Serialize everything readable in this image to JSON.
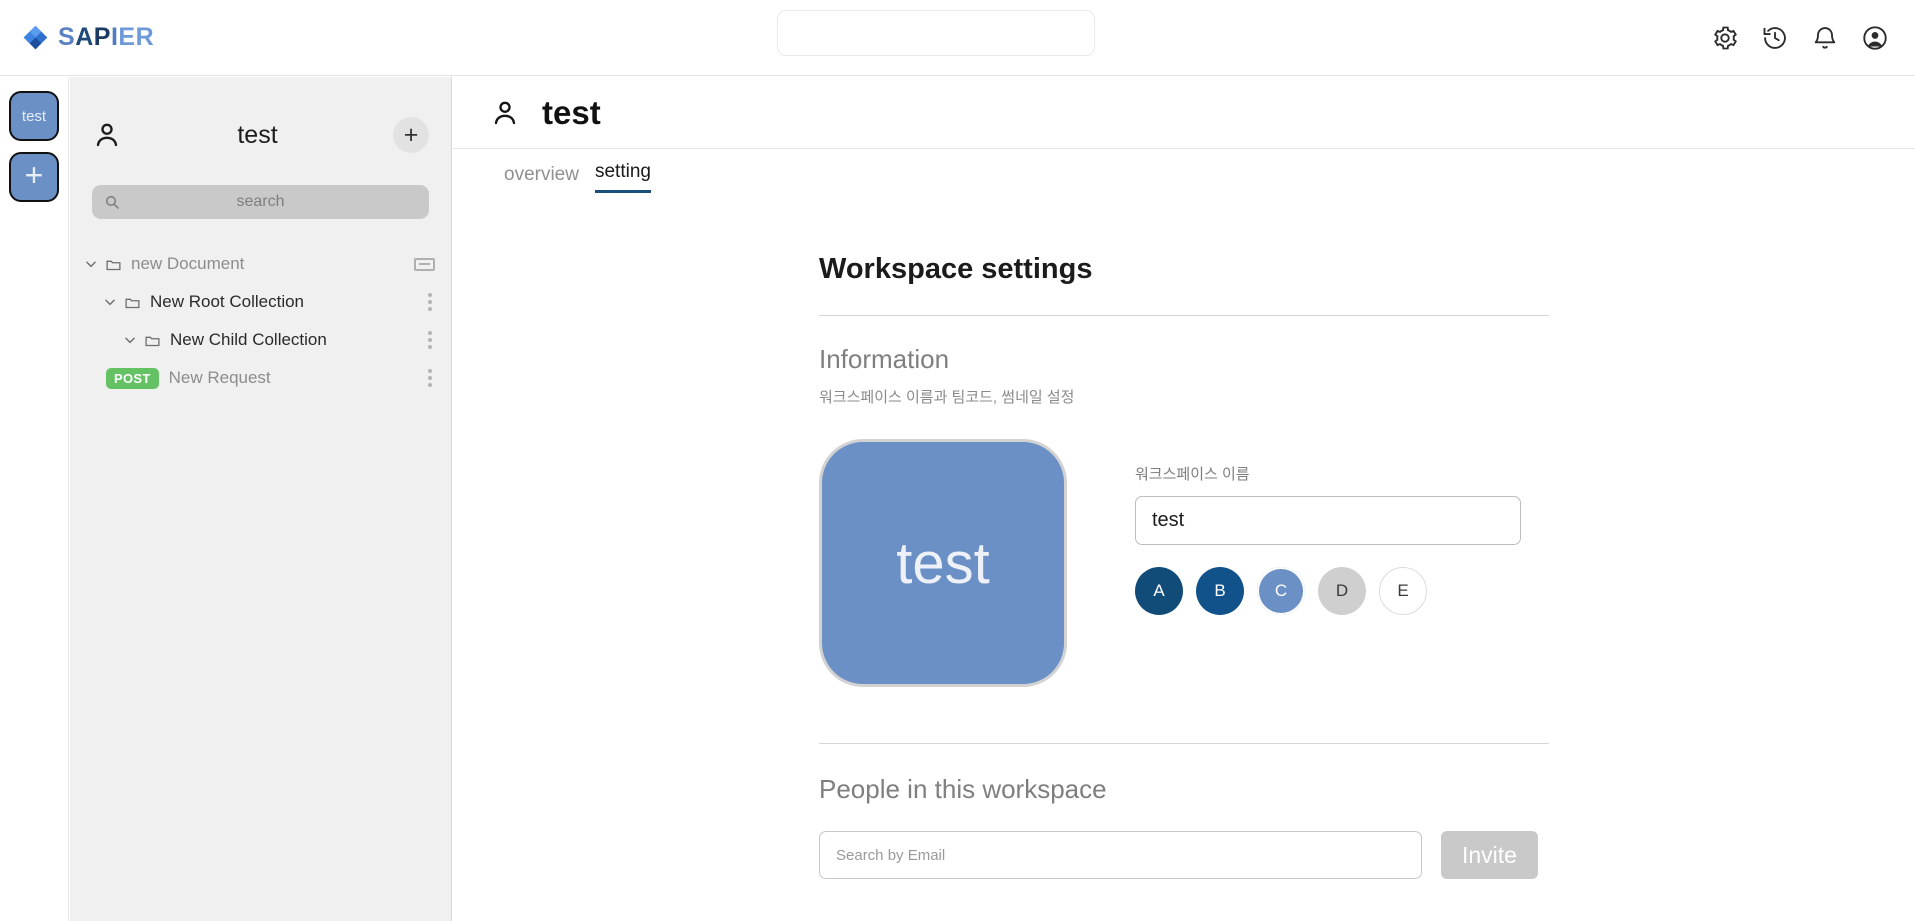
{
  "header": {
    "brand": {
      "letters": [
        "S",
        "A",
        "P",
        "I",
        "E",
        "R"
      ],
      "logo_icon": "diamond-logo-icon"
    },
    "search": {
      "value": "",
      "placeholder": ""
    },
    "icons": [
      {
        "name": "gear-icon",
        "label": "Settings"
      },
      {
        "name": "history-icon",
        "label": "History"
      },
      {
        "name": "bell-icon",
        "label": "Notifications"
      },
      {
        "name": "account-circle-icon",
        "label": "Account"
      }
    ]
  },
  "rail": {
    "workspace_button": "test",
    "add_button": "+"
  },
  "sidebar": {
    "person_icon": "person-icon",
    "title": "test",
    "add_label": "+",
    "search": {
      "value": "",
      "placeholder": "search",
      "icon": "search-icon"
    },
    "tree": [
      {
        "label": "new Document",
        "indent": 0,
        "style": "muted",
        "icon": "folder-icon",
        "chevron": "chevron-down-icon",
        "action": "rect-icon",
        "badge": null
      },
      {
        "label": "New Root Collection",
        "indent": 1,
        "style": "dark",
        "icon": "folder-icon",
        "chevron": "chevron-down-icon",
        "action": "dots",
        "badge": null
      },
      {
        "label": "New Child Collection",
        "indent": 2,
        "style": "dark",
        "icon": "folder-icon",
        "chevron": "chevron-down-icon",
        "action": "dots",
        "badge": null
      },
      {
        "label": "New Request",
        "indent": 3,
        "style": "muted",
        "icon": null,
        "chevron": null,
        "action": "dots",
        "badge": "POST"
      }
    ]
  },
  "main": {
    "person_icon": "person-icon",
    "title": "test",
    "tabs": [
      {
        "label": "overview",
        "active": false
      },
      {
        "label": "setting",
        "active": true
      }
    ],
    "panel_title": "Workspace settings",
    "information": {
      "heading": "Information",
      "subtitle": "워크스페이스 이름과 팀코드, 썸네일 설정",
      "thumbnail_text": "test",
      "name_label": "워크스페이스 이름",
      "name_value": "test",
      "swatches": [
        {
          "label": "A",
          "color": "#114b78",
          "text_color": "#ffffff",
          "selected": false
        },
        {
          "label": "B",
          "color": "#12528a",
          "text_color": "#ffffff",
          "selected": false
        },
        {
          "label": "C",
          "color": "#6b90c6",
          "text_color": "#ffffff",
          "selected": true
        },
        {
          "label": "D",
          "color": "#cfcfcf",
          "text_color": "#3a3a3a",
          "selected": false
        },
        {
          "label": "E",
          "color": "#ffffff",
          "text_color": "#3a3a3a",
          "selected": false
        }
      ]
    },
    "people": {
      "heading": "People in this workspace",
      "search_placeholder": "Search by Email",
      "search_value": "",
      "invite_label": "Invite"
    }
  },
  "colors": {
    "brand_blue": "#5b81c4",
    "accent_navy": "#1d4f7e",
    "thumbnail_blue": "#6b90c6",
    "post_green": "#64c264",
    "sidebar_bg": "#f0f0f0"
  }
}
